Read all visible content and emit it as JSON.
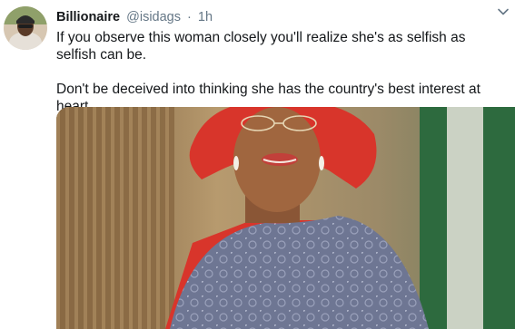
{
  "tweet": {
    "author_name": "Billionaire",
    "handle": "@isidags",
    "separator": "·",
    "timestamp": "1h",
    "paragraphs": [
      "If you observe this woman closely you'll realize she's as selfish as selfish can be.",
      "Don't be deceived into thinking she has the country's best interest at heart"
    ],
    "icons": {
      "avatar": "avatar",
      "more": "chevron-down-icon"
    }
  },
  "colors": {
    "text": "#14171a",
    "secondary_text": "#657786",
    "headwrap_red": "#d8352b",
    "lace_dress": "#6e7693",
    "curtain": "#8a6a44",
    "flag_green": "#2d6a3e"
  }
}
